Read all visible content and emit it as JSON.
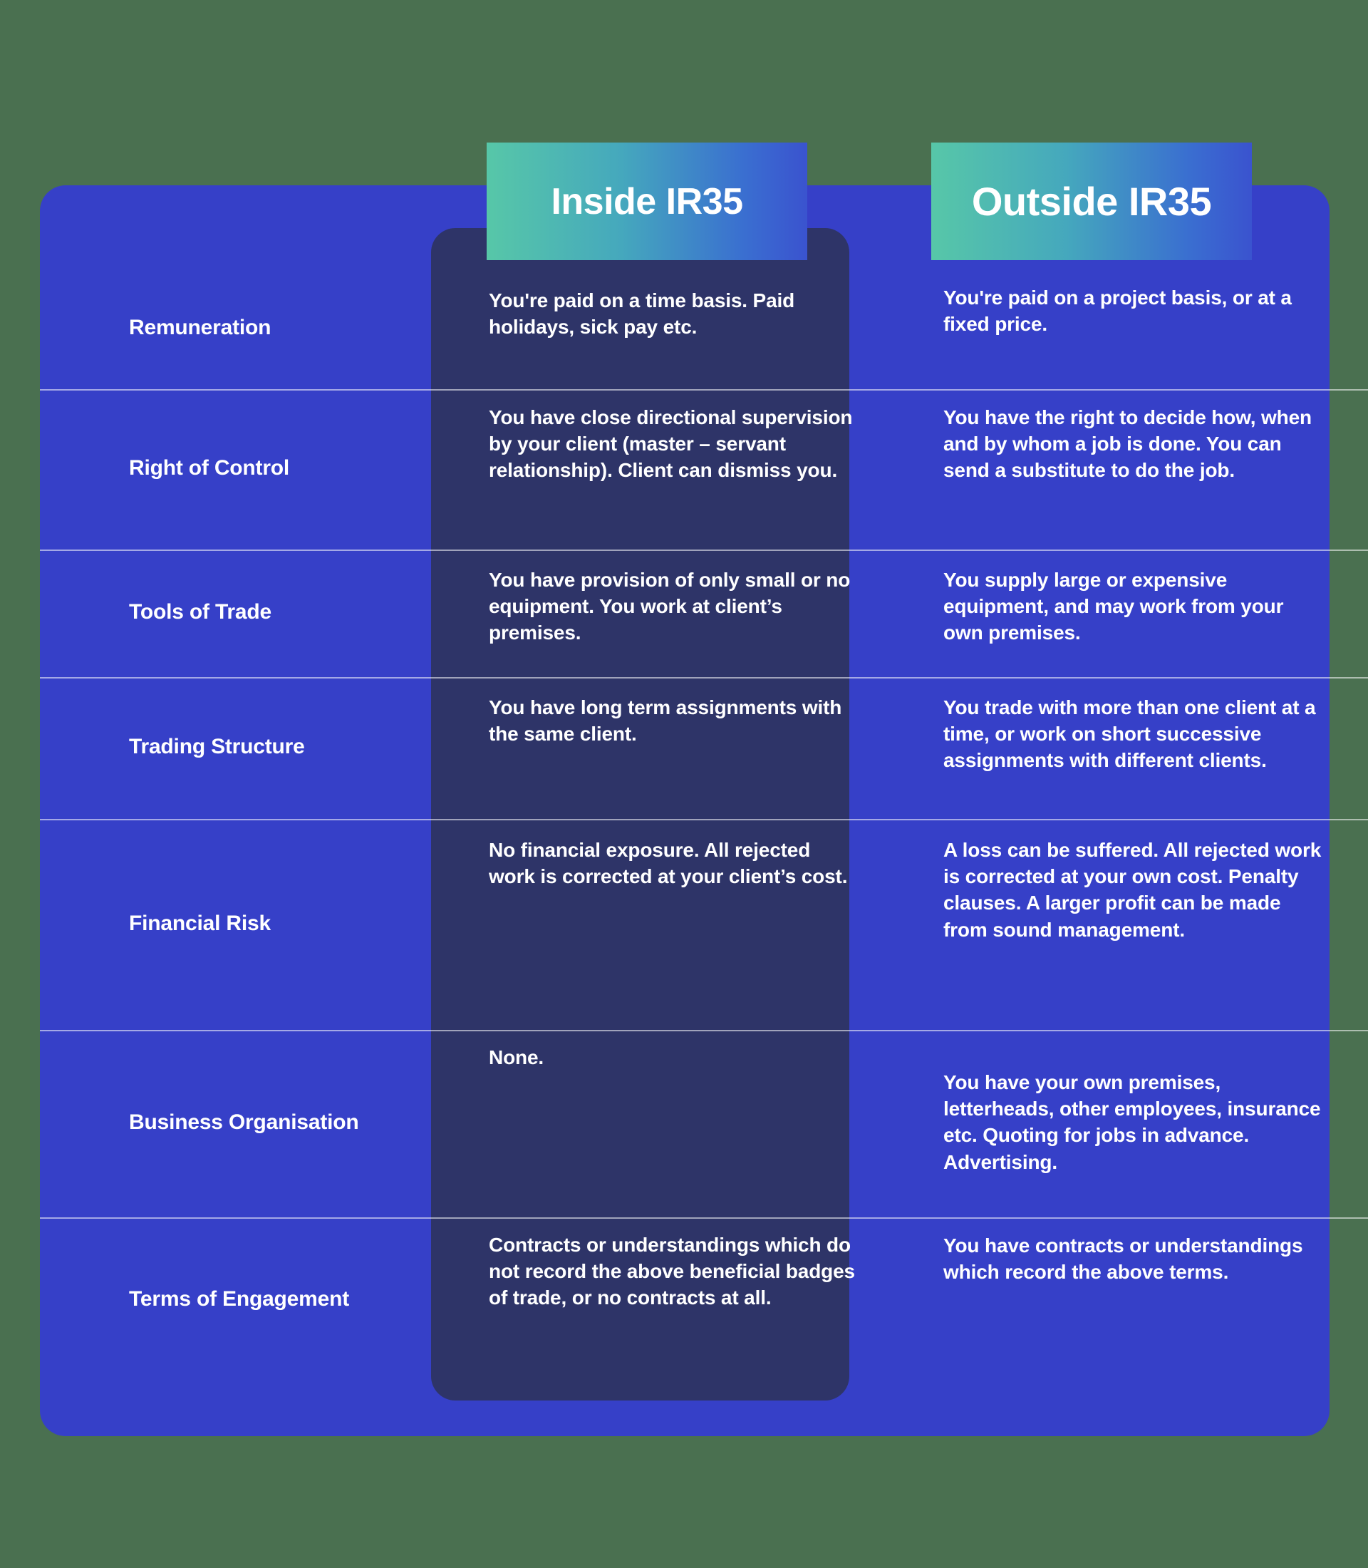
{
  "page": {
    "background_color": "#4a7050",
    "card_color": "#3640c8",
    "inside_panel_color": "#2e3468",
    "header_gradient_from": "#57c7a8",
    "header_gradient_to": "#3a53cf",
    "text_color": "#ffffff"
  },
  "headers": {
    "row_label_column": "",
    "inside": "Inside IR35",
    "outside": "Outside IR35"
  },
  "table": {
    "columns": [
      "",
      "Inside IR35",
      "Outside IR35"
    ],
    "rows": [
      {
        "label": "Remuneration",
        "inside": "You're paid on a time basis. Paid holidays, sick pay etc.",
        "outside": "You're paid on a project basis, or at a fixed price."
      },
      {
        "label": "Right of Control",
        "inside": "You have close directional supervision by your client (master – servant relationship). Client can dismiss you.",
        "outside": "You have the right to decide how, when and by whom a job is done. You can send a substitute to do the job."
      },
      {
        "label": "Tools of Trade",
        "inside": "You have provision of only small or no equipment. You work at client’s premises.",
        "outside": "You supply large or expensive equipment, and may work from your own premises."
      },
      {
        "label": "Trading Structure",
        "inside": "You have long term assignments with the same client.",
        "outside": "You trade with more than one client at a time, or work on short successive assignments with different clients."
      },
      {
        "label": "Financial Risk",
        "inside": "No financial exposure. All rejected work is corrected at your client’s cost.",
        "outside": "A loss can be suffered. All rejected work is corrected at your own cost. Penalty clauses. A larger profit can be made from sound management."
      },
      {
        "label": "Business Organisation",
        "inside": "None.",
        "outside": "You have your own premises, letterheads, other employees, insurance etc. Quoting for jobs in advance. Advertising."
      },
      {
        "label": "Terms of Engagement",
        "inside": "Contracts or understandings which do not record the above beneficial badges of trade, or no contracts at all.",
        "outside": "You have contracts or understandings which record the above terms."
      }
    ]
  }
}
